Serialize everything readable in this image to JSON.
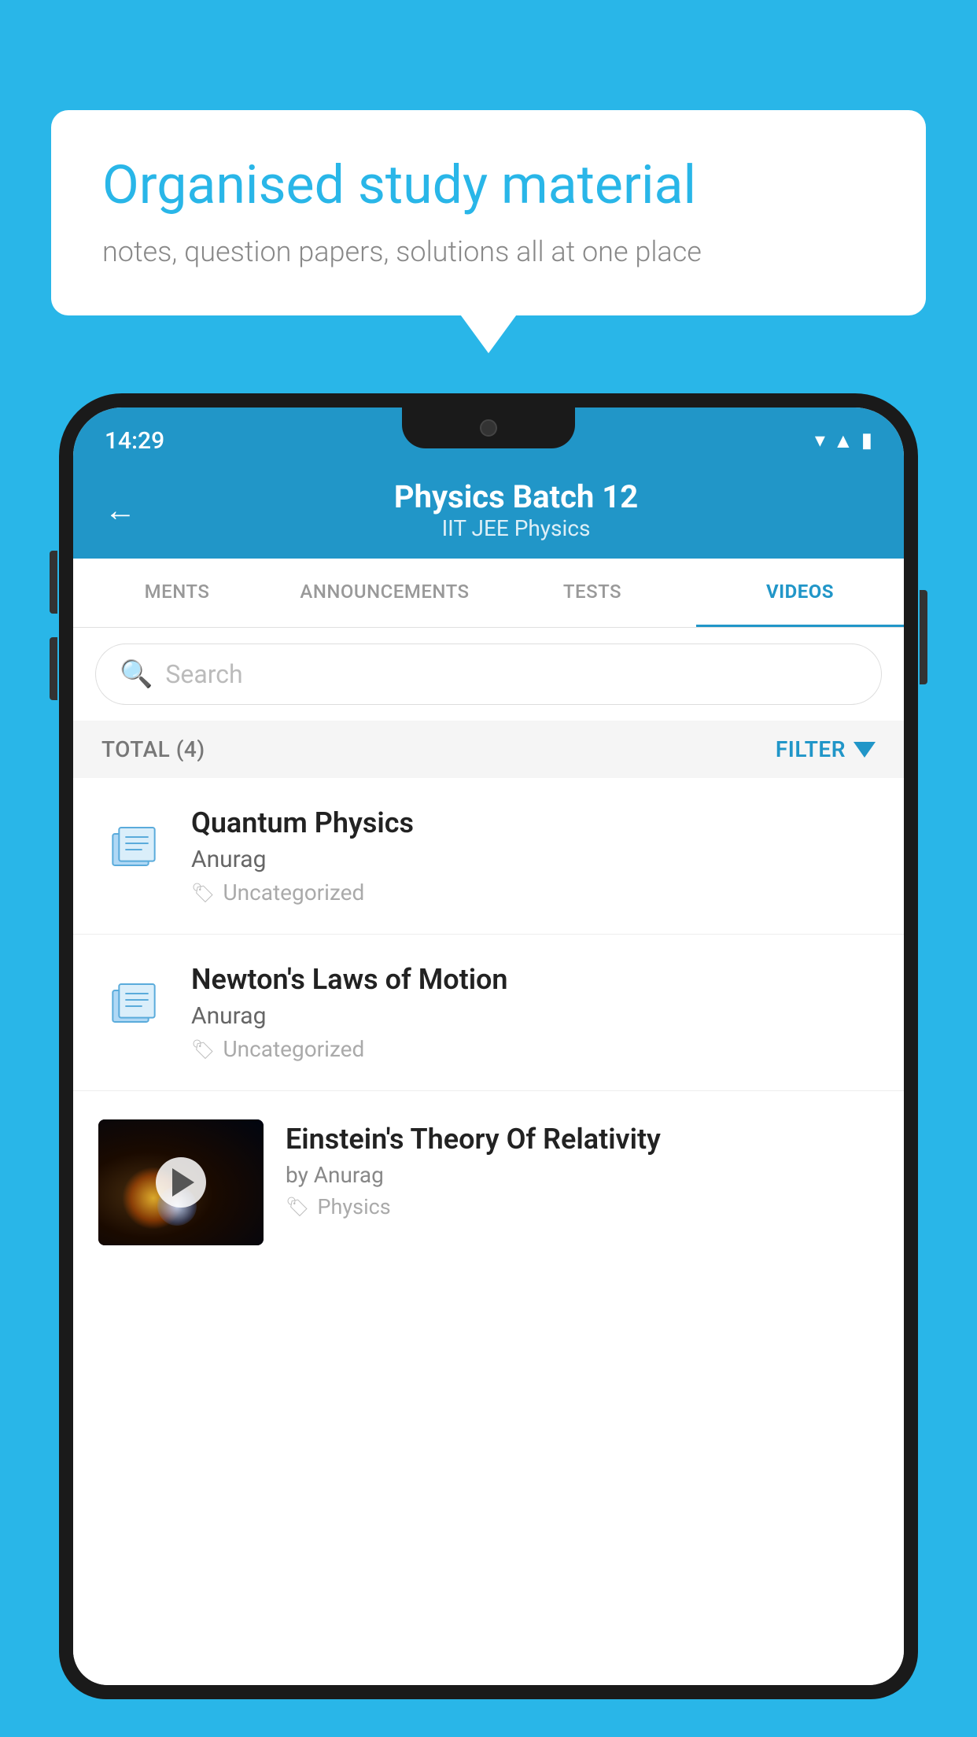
{
  "background_color": "#29b6e8",
  "speech_bubble": {
    "heading": "Organised study material",
    "subtext": "notes, question papers, solutions all at one place"
  },
  "phone": {
    "status_bar": {
      "time": "14:29",
      "icons": [
        "wifi",
        "signal",
        "battery"
      ]
    },
    "header": {
      "back_label": "←",
      "title": "Physics Batch 12",
      "subtitle": "IIT JEE   Physics"
    },
    "tabs": [
      {
        "label": "MENTS",
        "active": false
      },
      {
        "label": "ANNOUNCEMENTS",
        "active": false
      },
      {
        "label": "TESTS",
        "active": false
      },
      {
        "label": "VIDEOS",
        "active": true
      }
    ],
    "search": {
      "placeholder": "Search"
    },
    "filter_row": {
      "total_label": "TOTAL (4)",
      "filter_label": "FILTER"
    },
    "list_items": [
      {
        "title": "Quantum Physics",
        "author": "Anurag",
        "tag": "Uncategorized",
        "has_thumb": false
      },
      {
        "title": "Newton's Laws of Motion",
        "author": "Anurag",
        "tag": "Uncategorized",
        "has_thumb": false
      },
      {
        "title": "Einstein's Theory Of Relativity",
        "author": "by Anurag",
        "tag": "Physics",
        "has_thumb": true
      }
    ]
  }
}
